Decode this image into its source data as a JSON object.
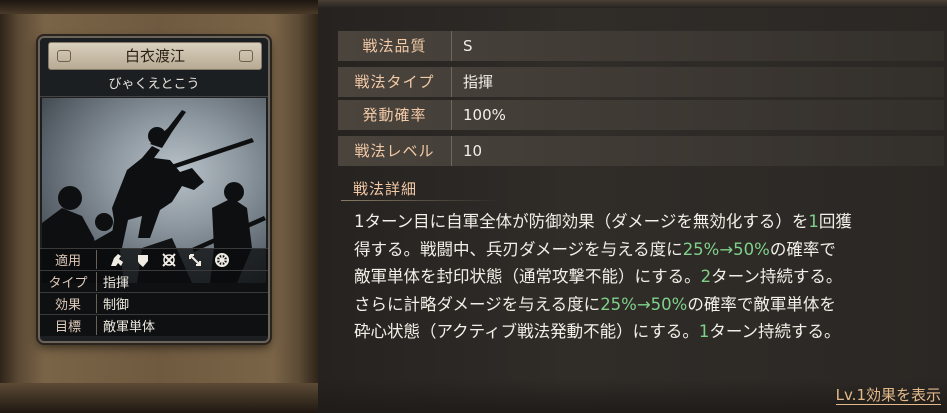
{
  "card": {
    "name": "白衣渡江",
    "reading": "びゃくえとこう",
    "stats": [
      {
        "key": "適用",
        "value": ""
      },
      {
        "key": "タイプ",
        "value": "指揮"
      },
      {
        "key": "効果",
        "value": "制御"
      },
      {
        "key": "目標",
        "value": "敵軍単体"
      }
    ],
    "applicable_icons": [
      "cavalry-icon",
      "shield-icon",
      "crossed-weapons-icon",
      "bow-icon",
      "wheel-icon"
    ]
  },
  "attributes": [
    {
      "key": "戦法品質",
      "value": "S"
    },
    {
      "key": "戦法タイプ",
      "value": "指揮"
    },
    {
      "key": "発動確率",
      "value": "100%"
    },
    {
      "key": "戦法レベル",
      "value": "10"
    }
  ],
  "detail": {
    "heading": "戦法詳細",
    "lines": [
      [
        {
          "t": "1ターン目に自軍全体が防御効果（ダメージを無効化する）を"
        },
        {
          "t": "1",
          "g": true
        },
        {
          "t": "回獲"
        }
      ],
      [
        {
          "t": "得する。戦闘中、兵刃ダメージを与える度に"
        },
        {
          "t": "25%→50%",
          "g": true
        },
        {
          "t": "の確率で"
        }
      ],
      [
        {
          "t": "敵軍単体を封印状態（通常攻撃不能）にする。"
        },
        {
          "t": "2",
          "g": true
        },
        {
          "t": "ターン持続する。"
        }
      ],
      [
        {
          "t": "さらに計略ダメージを与える度に"
        },
        {
          "t": "25%→50%",
          "g": true
        },
        {
          "t": "の確率で敵軍単体を"
        }
      ],
      [
        {
          "t": "砕心状態（アクティブ戦法発動不能）にする。"
        },
        {
          "t": "1",
          "g": true
        },
        {
          "t": "ターン持続する。"
        }
      ]
    ]
  },
  "footer_link": "Lv.1効果を表示"
}
